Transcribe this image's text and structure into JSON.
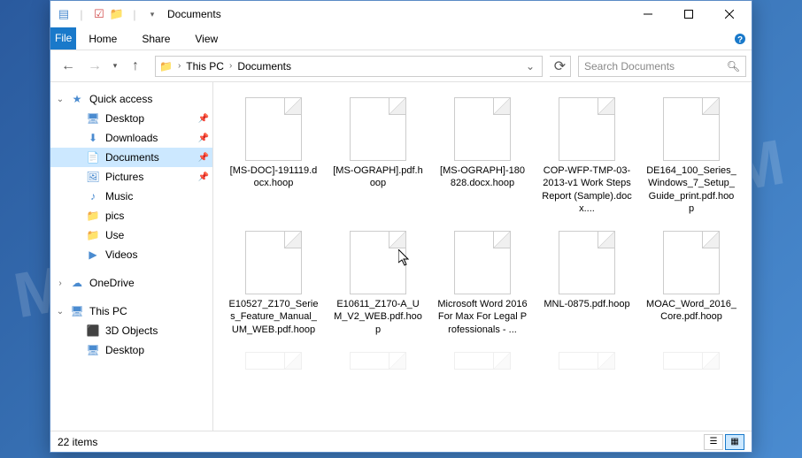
{
  "window": {
    "title": "Documents"
  },
  "ribbon": {
    "file": "File",
    "home": "Home",
    "share": "Share",
    "view": "View"
  },
  "breadcrumb": {
    "root": "This PC",
    "current": "Documents"
  },
  "search": {
    "placeholder": "Search Documents"
  },
  "nav": {
    "quick_access": "Quick access",
    "desktop": "Desktop",
    "downloads": "Downloads",
    "documents": "Documents",
    "pictures": "Pictures",
    "music": "Music",
    "pics": "pics",
    "use": "Use",
    "videos": "Videos",
    "onedrive": "OneDrive",
    "this_pc": "This PC",
    "objects3d": "3D Objects",
    "desktop2": "Desktop"
  },
  "files": [
    "[MS-DOC]-191119.docx.hoop",
    "[MS-OGRAPH].pdf.hoop",
    "[MS-OGRAPH]-180828.docx.hoop",
    "COP-WFP-TMP-03-2013-v1 Work Steps Report (Sample).docx....",
    "DE164_100_Series_Windows_7_Setup_Guide_print.pdf.hoop",
    "E10527_Z170_Series_Feature_Manual_UM_WEB.pdf.hoop",
    "E10611_Z170-A_UM_V2_WEB.pdf.hoop",
    "Microsoft Word 2016 For Max For Legal Professionals - ...",
    "MNL-0875.pdf.hoop",
    "MOAC_Word_2016_Core.pdf.hoop"
  ],
  "status": {
    "count": "22 items"
  },
  "watermark": "MYANTISPYWARE.COM"
}
